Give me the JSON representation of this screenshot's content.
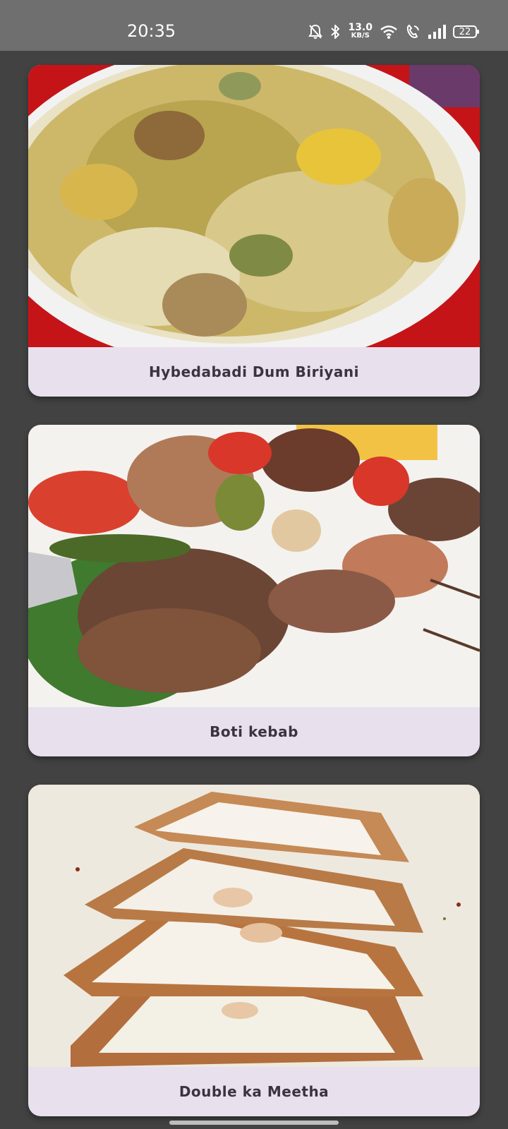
{
  "status_bar": {
    "time": "20:35",
    "net_speed_value": "13.0",
    "net_speed_unit": "KB/S",
    "battery": "22",
    "icons": [
      "mute-icon",
      "bluetooth-icon",
      "wifi-icon",
      "wifi-calling-icon",
      "signal-icon"
    ]
  },
  "cards": [
    {
      "title": "Hybedabadi Dum Biriyani",
      "image": "biryani-photo"
    },
    {
      "title": "Boti kebab",
      "image": "kebab-photo"
    },
    {
      "title": "Double ka Meetha",
      "image": "double-ka-meetha-photo"
    }
  ],
  "colors": {
    "background": "#424242",
    "status_bar": "#6f6f6f",
    "card_caption": "#e8e0ec",
    "caption_text": "#3b3440"
  }
}
